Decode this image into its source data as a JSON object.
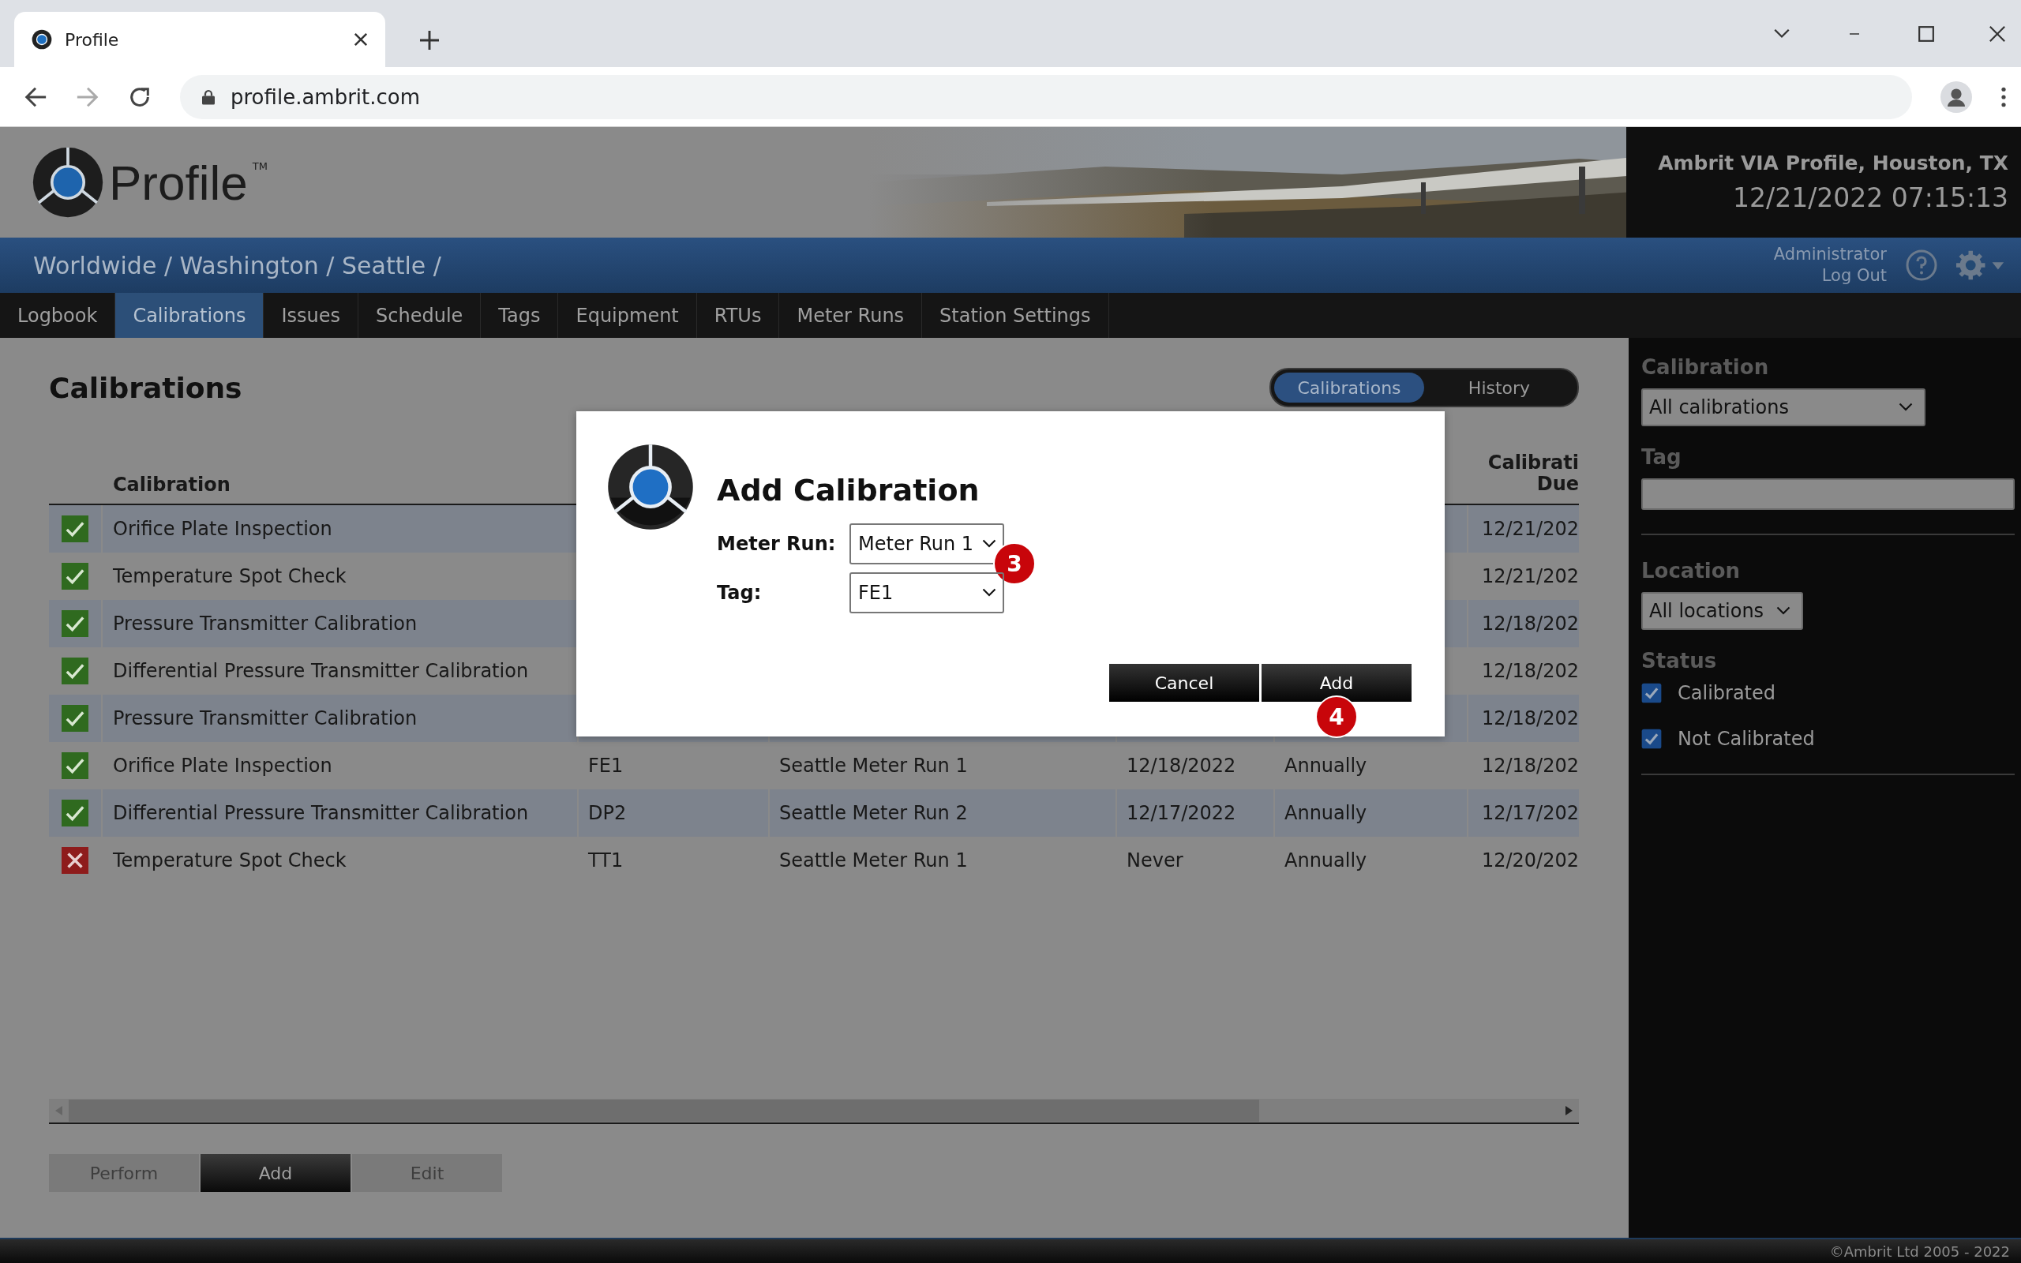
{
  "browser": {
    "tab_title": "Profile",
    "url": "profile.ambrit.com"
  },
  "header": {
    "logo_text": "Profile",
    "trademark": "TM",
    "site": "Ambrit VIA Profile, Houston, TX",
    "datetime": "12/21/2022 07:15:13"
  },
  "breadcrumb": "Worldwide / Washington / Seattle /",
  "user": {
    "name": "Administrator",
    "logout": "Log Out"
  },
  "nav": [
    {
      "label": "Logbook",
      "selected": false
    },
    {
      "label": "Calibrations",
      "selected": true
    },
    {
      "label": "Issues",
      "selected": false
    },
    {
      "label": "Schedule",
      "selected": false
    },
    {
      "label": "Tags",
      "selected": false
    },
    {
      "label": "Equipment",
      "selected": false
    },
    {
      "label": "RTUs",
      "selected": false
    },
    {
      "label": "Meter Runs",
      "selected": false
    },
    {
      "label": "Station Settings",
      "selected": false
    }
  ],
  "page_title": "Calibrations",
  "view_toggle": [
    {
      "label": "Calibrations",
      "selected": true
    },
    {
      "label": "History",
      "selected": false
    }
  ],
  "table": {
    "calibration_header": "Calibration",
    "due_header": [
      "Calibrati",
      "Due"
    ],
    "rows": [
      {
        "calibrated": true,
        "name": "Orifice Plate Inspection",
        "due": "12/21/202"
      },
      {
        "calibrated": true,
        "name": "Temperature Spot Check",
        "due": "12/21/202"
      },
      {
        "calibrated": true,
        "name": "Pressure Transmitter Calibration",
        "due": "12/18/202"
      },
      {
        "calibrated": true,
        "name": "Differential Pressure Transmitter Calibration",
        "due": "12/18/202"
      },
      {
        "calibrated": true,
        "name": "Pressure Transmitter Calibration",
        "due": "12/18/202"
      },
      {
        "calibrated": true,
        "name": "Orifice Plate Inspection",
        "tag": "FE1",
        "location": "Seattle Meter Run 1",
        "last": "12/18/2022",
        "frequency": "Annually",
        "due": "12/18/202"
      },
      {
        "calibrated": true,
        "name": "Differential Pressure Transmitter Calibration",
        "tag": "DP2",
        "location": "Seattle Meter Run 2",
        "last": "12/17/2022",
        "frequency": "Annually",
        "due": "12/17/202"
      },
      {
        "calibrated": false,
        "name": "Temperature Spot Check",
        "tag": "TT1",
        "location": "Seattle Meter Run 1",
        "last": "Never",
        "frequency": "Annually",
        "due": "12/20/202"
      }
    ]
  },
  "actions": [
    {
      "label": "Perform",
      "disabled": true
    },
    {
      "label": "Add",
      "disabled": false
    },
    {
      "label": "Edit",
      "disabled": true
    }
  ],
  "sidebar": {
    "calibration_label": "Calibration",
    "calibration_value": "All calibrations",
    "tag_label": "Tag",
    "location_label": "Location",
    "location_value": "All locations",
    "status_label": "Status",
    "statuses": [
      {
        "label": "Calibrated",
        "checked": true
      },
      {
        "label": "Not Calibrated",
        "checked": true
      }
    ]
  },
  "dialog": {
    "title": "Add Calibration",
    "fields": [
      {
        "label": "Meter Run:",
        "value": "Meter Run 1",
        "callout": "3"
      },
      {
        "label": "Tag:",
        "value": "FE1"
      }
    ],
    "buttons": [
      {
        "label": "Cancel",
        "kind": "cancel"
      },
      {
        "label": "Add",
        "kind": "confirm",
        "callout": "4"
      }
    ]
  },
  "footer": "©Ambrit Ltd 2005 - 2022"
}
